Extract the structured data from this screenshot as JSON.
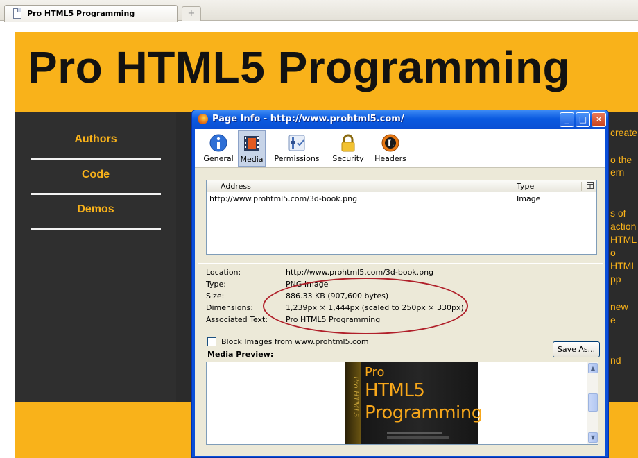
{
  "browser": {
    "tab_title": "Pro HTML5 Programming",
    "new_tab_symbol": "+"
  },
  "site": {
    "title": "Pro HTML5 Programming",
    "nav": [
      "Authors",
      "Code",
      "Demos"
    ],
    "content_fragments": [
      "create",
      "o the",
      "ern",
      "s of",
      "action",
      "HTML",
      "o",
      "HTML",
      "pp",
      "new",
      "e",
      "nd"
    ],
    "colors": {
      "accent": "#f9b21a",
      "sidebar": "#2f2f2f"
    }
  },
  "dialog": {
    "title": "Page Info - http://www.prohtml5.com/",
    "window_buttons": {
      "minimize": "_",
      "maximize": "□",
      "close": "✕"
    },
    "tabs": [
      {
        "label": "General",
        "icon": "info-icon",
        "selected": false
      },
      {
        "label": "Media",
        "icon": "media-film-icon",
        "selected": true
      },
      {
        "label": "Permissions",
        "icon": "permissions-icon",
        "selected": false
      },
      {
        "label": "Security",
        "icon": "padlock-icon",
        "selected": false
      },
      {
        "label": "Headers",
        "icon": "headers-icon",
        "selected": false
      }
    ],
    "media_list": {
      "columns": [
        "Address",
        "Type"
      ],
      "column_picker_icon": "column-picker-icon",
      "rows": [
        {
          "address": "http://www.prohtml5.com/3d-book.png",
          "type": "Image"
        }
      ]
    },
    "properties": [
      {
        "key": "Location:",
        "value": "http://www.prohtml5.com/3d-book.png"
      },
      {
        "key": "Type:",
        "value": "PNG Image"
      },
      {
        "key": "Size:",
        "value": "886.33 KB (907,600 bytes)"
      },
      {
        "key": "Dimensions:",
        "value": "1,239px × 1,444px (scaled to 250px × 330px)"
      },
      {
        "key": "Associated Text:",
        "value": "Pro HTML5 Programming"
      }
    ],
    "block_images_label": "Block Images from www.prohtml5.com",
    "block_images_checked": false,
    "save_as_label": "Save As...",
    "media_preview_label": "Media Preview:",
    "preview_book": {
      "line1": "Pro",
      "line2": "HTML5",
      "line3": "Programming",
      "spine": "Pro HTML5"
    }
  }
}
